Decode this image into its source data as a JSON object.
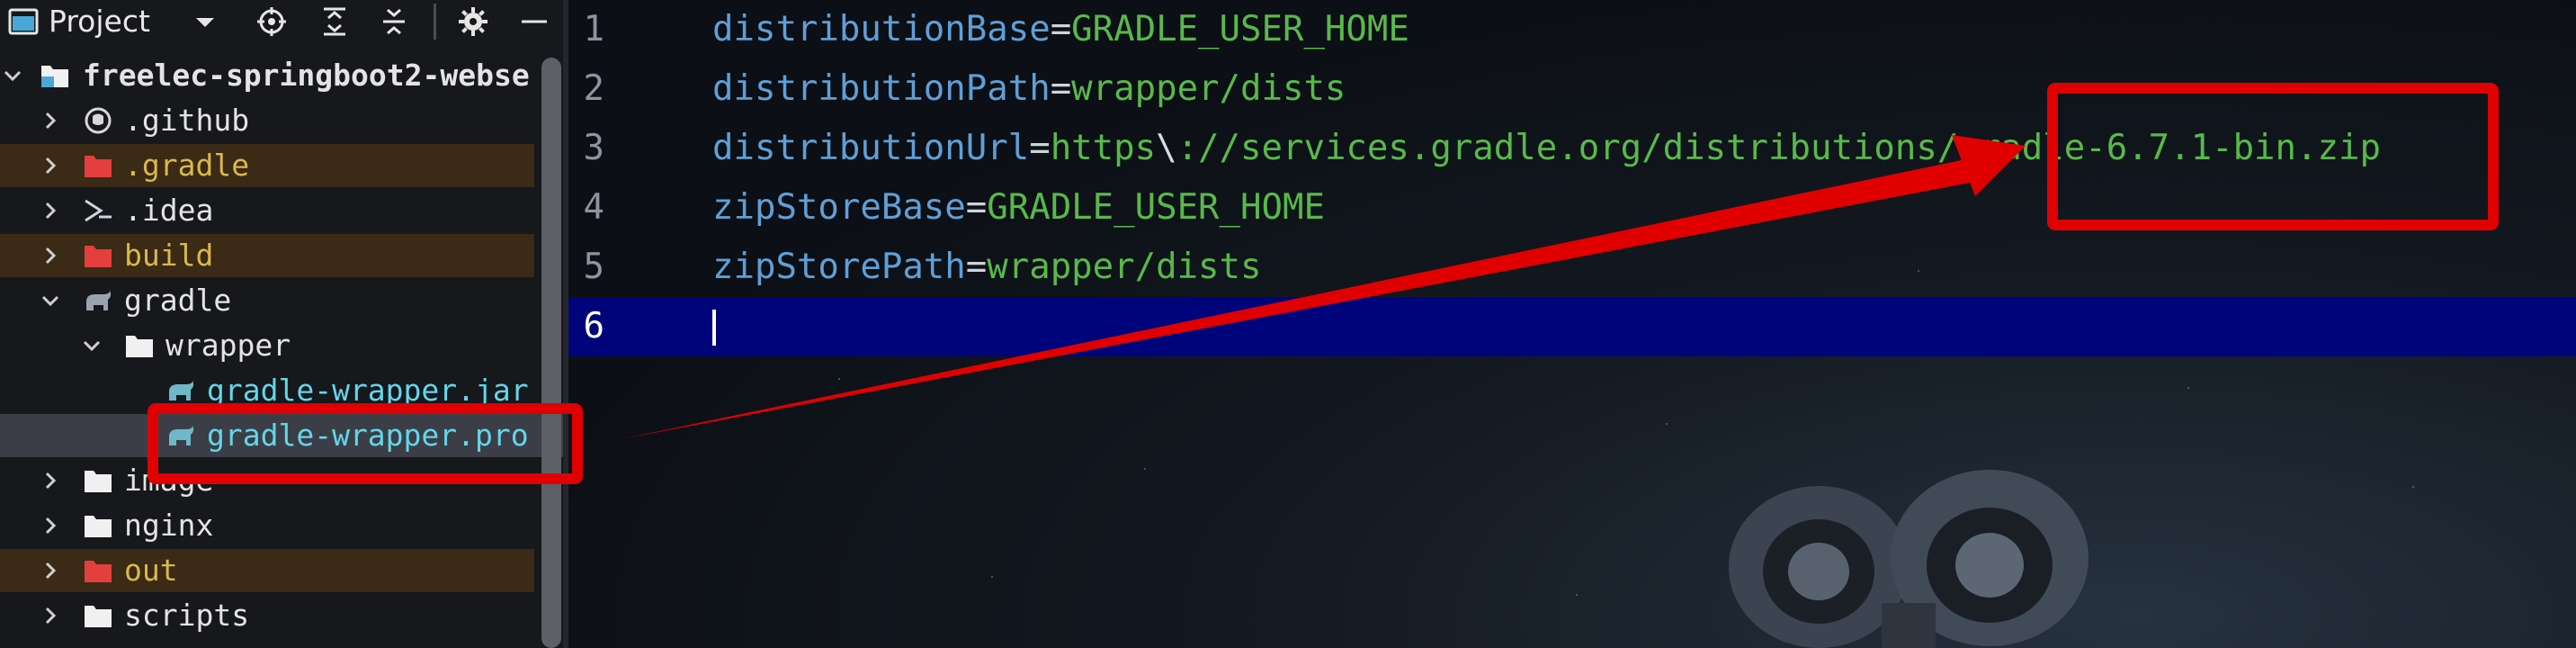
{
  "project_panel": {
    "title": "Project",
    "tree": [
      {
        "label": "freelec-springboot2-webse",
        "kind": "module",
        "expanded": true
      },
      {
        "label": ".github",
        "kind": "github"
      },
      {
        "label": ".gradle",
        "kind": "excluded-folder"
      },
      {
        "label": ".idea",
        "kind": "idea"
      },
      {
        "label": "build",
        "kind": "excluded-folder"
      },
      {
        "label": "gradle",
        "kind": "gradle-folder",
        "expanded": true
      },
      {
        "label": "wrapper",
        "kind": "folder",
        "expanded": true
      },
      {
        "label": "gradle-wrapper.jar",
        "kind": "gradle-file"
      },
      {
        "label": "gradle-wrapper.pro",
        "kind": "gradle-file",
        "selected": true
      },
      {
        "label": "image",
        "kind": "folder"
      },
      {
        "label": "nginx",
        "kind": "folder"
      },
      {
        "label": "out",
        "kind": "excluded-folder"
      },
      {
        "label": "scripts",
        "kind": "folder"
      }
    ]
  },
  "editor": {
    "current_line": 6,
    "lines": [
      {
        "number": "1",
        "key": "distributionBase",
        "eq": "=",
        "value": "GRADLE_USER_HOME"
      },
      {
        "number": "2",
        "key": "distributionPath",
        "eq": "=",
        "value": "wrapper/dists"
      },
      {
        "number": "3",
        "key": "distributionUrl",
        "eq": "=",
        "value_a": "https",
        "escape": "\\",
        "value_b": "://services.gradle.org/distributions/gradle-6.7.1-bin.zip"
      },
      {
        "number": "4",
        "key": "zipStoreBase",
        "eq": "=",
        "value": "GRADLE_USER_HOME"
      },
      {
        "number": "5",
        "key": "zipStorePath",
        "eq": "=",
        "value": "wrapper/dists"
      },
      {
        "number": "6"
      }
    ]
  },
  "colors": {
    "key": "#5f9fd6",
    "value": "#58b94a",
    "current_line_bg": "#00047a",
    "annotation_red": "#e00000",
    "excluded_folder": "#e53e3e"
  }
}
